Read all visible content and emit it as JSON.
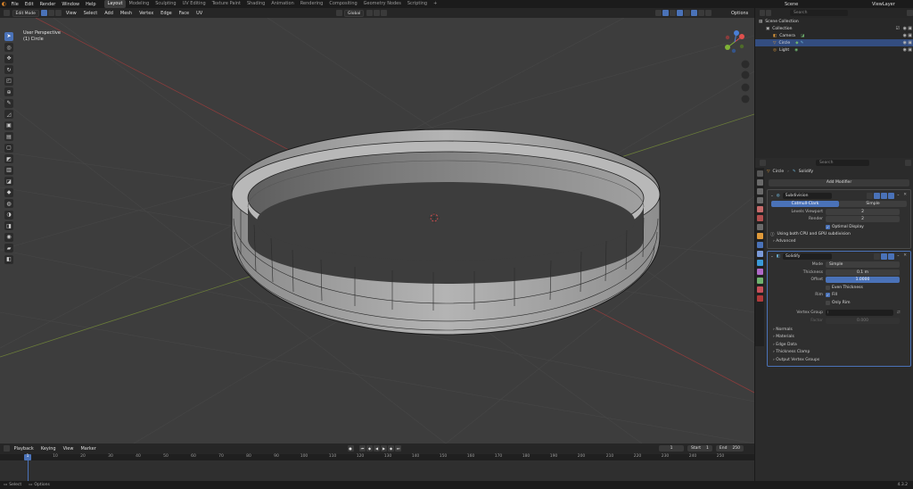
{
  "topbar": {
    "menus": [
      "File",
      "Edit",
      "Render",
      "Window",
      "Help"
    ],
    "workspaces": [
      "Layout",
      "Modeling",
      "Sculpting",
      "UV Editing",
      "Texture Paint",
      "Shading",
      "Animation",
      "Rendering",
      "Compositing",
      "Geometry Nodes",
      "Scripting"
    ],
    "active_workspace": "Layout",
    "add_workspace": "+",
    "scene_label": "Scene",
    "viewlayer_label": "ViewLayer"
  },
  "viewport_header": {
    "mode": "Edit Mode",
    "menus": [
      "View",
      "Select",
      "Add",
      "Mesh",
      "Vertex",
      "Edge",
      "Face",
      "UV"
    ],
    "transform_orientation": "Global",
    "options": "Options"
  },
  "viewport": {
    "view_name": "User Perspective",
    "object_label": "(1) Circle",
    "gizmo": {
      "x_axis": "X",
      "y_axis": "Y",
      "z_axis": "Z"
    }
  },
  "timeline": {
    "menus": [
      "Playback",
      "Keying",
      "View",
      "Marker"
    ],
    "current_frame": "1",
    "start_label": "Start",
    "start_value": "1",
    "end_label": "End",
    "end_value": "250",
    "ticks": [
      "10",
      "20",
      "30",
      "40",
      "50",
      "60",
      "70",
      "80",
      "90",
      "100",
      "110",
      "120",
      "130",
      "140",
      "150",
      "160",
      "170",
      "180",
      "190",
      "200",
      "210",
      "220",
      "230",
      "240",
      "250"
    ]
  },
  "statusbar": {
    "left": "Select",
    "right": "Options",
    "version": "4.3.2"
  },
  "outliner": {
    "search_placeholder": "Search",
    "scene_collection": "Scene Collection",
    "collection": "Collection",
    "items": [
      {
        "name": "Camera",
        "selected": false
      },
      {
        "name": "Circle",
        "selected": true
      },
      {
        "name": "Light",
        "selected": false
      }
    ]
  },
  "properties": {
    "search_placeholder": "Search",
    "breadcrumb_object": "Circle",
    "breadcrumb_sep": "›",
    "breadcrumb_modifier": "Solidify",
    "add_modifier": "Add Modifier",
    "subdivision": {
      "name": "Subdivision",
      "algo_options": [
        "Catmull-Clark",
        "Simple"
      ],
      "active_algo": "Catmull-Clark",
      "levels_viewport_label": "Levels Viewport",
      "levels_viewport_value": "2",
      "render_label": "Render",
      "render_value": "2",
      "optimal_display": "Optimal Display",
      "info": "Using both CPU and GPU subdivision",
      "advanced": "Advanced"
    },
    "solidify": {
      "name": "Solidify",
      "mode_label": "Mode",
      "mode_value": "Simple",
      "thickness_label": "Thickness",
      "thickness_value": "0.1 m",
      "offset_label": "Offset",
      "offset_value": "1.0000",
      "offset_fraction": 1.0,
      "even_thickness": "Even Thickness",
      "rim_label": "Rim",
      "fill": "Fill",
      "only_rim": "Only Rim",
      "vertex_group_label": "Vertex Group",
      "factor_label": "Factor",
      "factor_value": "0.000",
      "subpanels": [
        "Normals",
        "Materials",
        "Edge Data",
        "Thickness Clamp",
        "Output Vertex Groups"
      ]
    }
  },
  "colors": {
    "accent": "#4a72b8",
    "viewport_bg": "#3d3d3d",
    "x_axis": "#e0504d",
    "y_axis": "#7fb236",
    "z_axis": "#4a7fd6"
  }
}
